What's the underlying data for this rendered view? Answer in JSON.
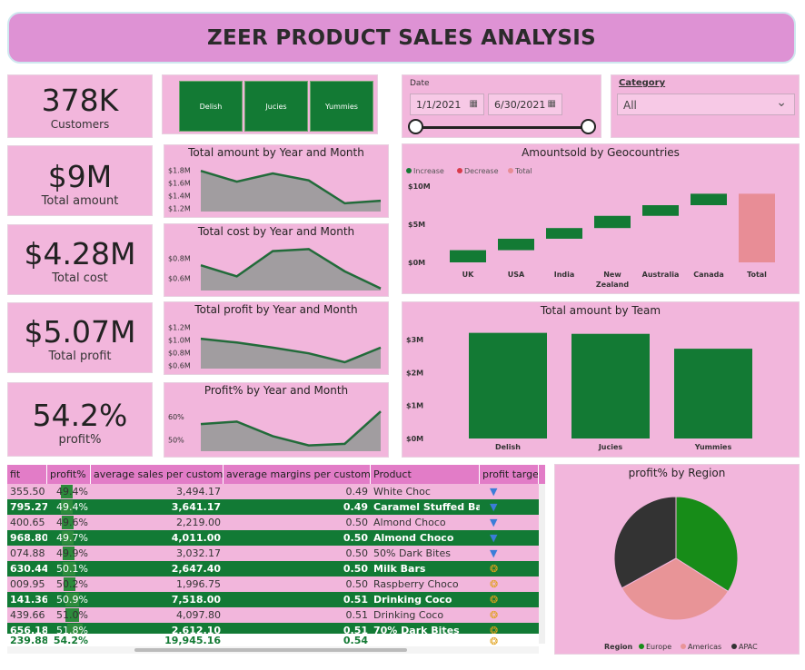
{
  "header": {
    "title": "ZEER PRODUCT SALES ANALYSIS"
  },
  "kpis": {
    "customers": {
      "value": "378K",
      "label": "Customers"
    },
    "total_amount": {
      "value": "$9M",
      "label": "Total amount"
    },
    "total_cost": {
      "value": "$4.28M",
      "label": "Total cost"
    },
    "total_profit": {
      "value": "$5.07M",
      "label": "Total profit"
    },
    "profit_pct": {
      "value": "54.2%",
      "label": "profit%"
    }
  },
  "team_slicer": {
    "buttons": [
      "Delish",
      "Jucies",
      "Yummies"
    ]
  },
  "date_slicer": {
    "label": "Date",
    "start": "1/1/2021",
    "end": "6/30/2021"
  },
  "category_slicer": {
    "label": "Category",
    "value": "All"
  },
  "colors": {
    "title_bg": "#de92d4",
    "panel_bg": "#f2b6dc",
    "green": "#137a34",
    "line": "#226b3a",
    "area": "#9c9c9c",
    "total_bar": "#e88d96",
    "apac": "#333333",
    "americas": "#e89497",
    "europe": "#178c18"
  },
  "chart_data": [
    {
      "type": "area",
      "title": "Total amount by Year and Month",
      "y_ticks": [
        "$1.8M",
        "$1.6M",
        "$1.4M",
        "$1.2M"
      ],
      "ylim": [
        1.15,
        1.85
      ],
      "values": [
        1.79,
        1.62,
        1.75,
        1.64,
        1.28,
        1.32
      ]
    },
    {
      "type": "area",
      "title": "Total cost by Year and Month",
      "y_ticks": [
        "$0.8M",
        "$0.6M"
      ],
      "ylim": [
        0.48,
        0.92
      ],
      "values": [
        0.73,
        0.62,
        0.87,
        0.89,
        0.67,
        0.5
      ]
    },
    {
      "type": "area",
      "title": "Total profit by Year and Month",
      "y_ticks": [
        "$1.2M",
        "$1.0M",
        "$0.8M",
        "$0.6M"
      ],
      "ylim": [
        0.55,
        1.25
      ],
      "values": [
        1.02,
        0.96,
        0.88,
        0.79,
        0.65,
        0.88
      ]
    },
    {
      "type": "area",
      "title": "Profit% by Year and Month",
      "y_ticks": [
        "60%",
        "50%"
      ],
      "ylim": [
        45,
        65
      ],
      "values": [
        56.7,
        57.8,
        51.5,
        47.5,
        48.2,
        62.2
      ]
    },
    {
      "type": "waterfall",
      "title": "Amountsold by Geocountries",
      "legend": [
        "Increase",
        "Decrease",
        "Total"
      ],
      "y_ticks": [
        "$10M",
        "$5M",
        "$0M"
      ],
      "ylim": [
        0,
        10
      ],
      "categories": [
        "UK",
        "USA",
        "India",
        "New Zealand",
        "Australia",
        "Canada",
        "Total"
      ],
      "values": [
        1.6,
        1.5,
        1.4,
        1.6,
        1.4,
        1.5,
        9.0
      ]
    },
    {
      "type": "bar",
      "title": "Total amount by Team",
      "y_ticks": [
        "$3M",
        "$2M",
        "$1M",
        "$0M"
      ],
      "ylim": [
        0,
        3.3
      ],
      "categories": [
        "Delish",
        "Jucies",
        "Yummies"
      ],
      "values": [
        3.2,
        3.17,
        2.72
      ]
    },
    {
      "type": "pie",
      "title": "profit% by Region",
      "legend_title": "Region",
      "categories": [
        "Europe",
        "Americas",
        "APAC"
      ],
      "values": [
        34,
        33,
        33
      ]
    }
  ],
  "table": {
    "columns": [
      "fit",
      "profit%",
      "average sales per customer",
      "average margins per customer",
      "Product",
      "profit targe"
    ],
    "rows": [
      [
        "355.50",
        "49.4%",
        "3,494.17",
        "0.49",
        "White Choc"
      ],
      [
        "795.27",
        "49.4%",
        "3,641.17",
        "0.49",
        "Caramel Stuffed Bars"
      ],
      [
        "400.65",
        "49.6%",
        "2,219.00",
        "0.50",
        "Almond Choco"
      ],
      [
        "968.80",
        "49.7%",
        "4,011.00",
        "0.50",
        "Almond Choco"
      ],
      [
        "074.88",
        "49.9%",
        "3,032.17",
        "0.50",
        "50% Dark Bites"
      ],
      [
        "630.44",
        "50.1%",
        "2,647.40",
        "0.50",
        "Milk Bars"
      ],
      [
        "009.95",
        "50.2%",
        "1,996.75",
        "0.50",
        "Raspberry Choco"
      ],
      [
        "141.36",
        "50.9%",
        "7,518.00",
        "0.51",
        "Drinking Coco"
      ],
      [
        "439.66",
        "51.0%",
        "4,097.80",
        "0.51",
        "Drinking Coco"
      ],
      [
        "656.18",
        "51.8%",
        "2,612.10",
        "0.51",
        "70% Dark Bites"
      ]
    ],
    "total": [
      "239.88",
      "54.2%",
      "19,945.16",
      "0.54",
      ""
    ]
  }
}
